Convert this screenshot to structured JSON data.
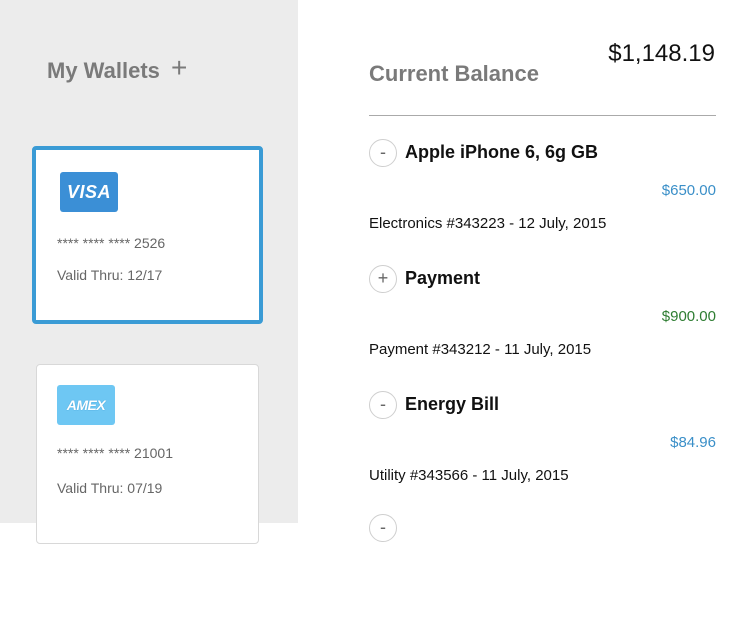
{
  "sidebar": {
    "title": "My Wallets",
    "add_icon": "+",
    "cards": [
      {
        "brand": "VISA",
        "number": "**** **** **** 2526",
        "valid": "Valid Thru: 12/17",
        "selected": true
      },
      {
        "brand": "AMEX",
        "number": "**** **** **** 21001",
        "valid": "Valid Thru: 07/19",
        "selected": false
      }
    ]
  },
  "main": {
    "balance_label": "Current Balance",
    "balance_amount": "$1,148.19",
    "transactions": [
      {
        "toggle": "-",
        "title": "Apple iPhone 6, 6g GB",
        "amount": "$650.00",
        "amount_color": "#3a8fc8",
        "detail": "Electronics #343223 - 12 July, 2015"
      },
      {
        "toggle": "+",
        "title": "Payment",
        "amount": "$900.00",
        "amount_color": "#2e7d32",
        "detail": "Payment #343212 - 11 July, 2015"
      },
      {
        "toggle": "-",
        "title": "Energy Bill",
        "amount": "$84.96",
        "amount_color": "#3a8fc8",
        "detail": "Utility #343566 - 11 July, 2015"
      },
      {
        "toggle": "-"
      }
    ]
  }
}
